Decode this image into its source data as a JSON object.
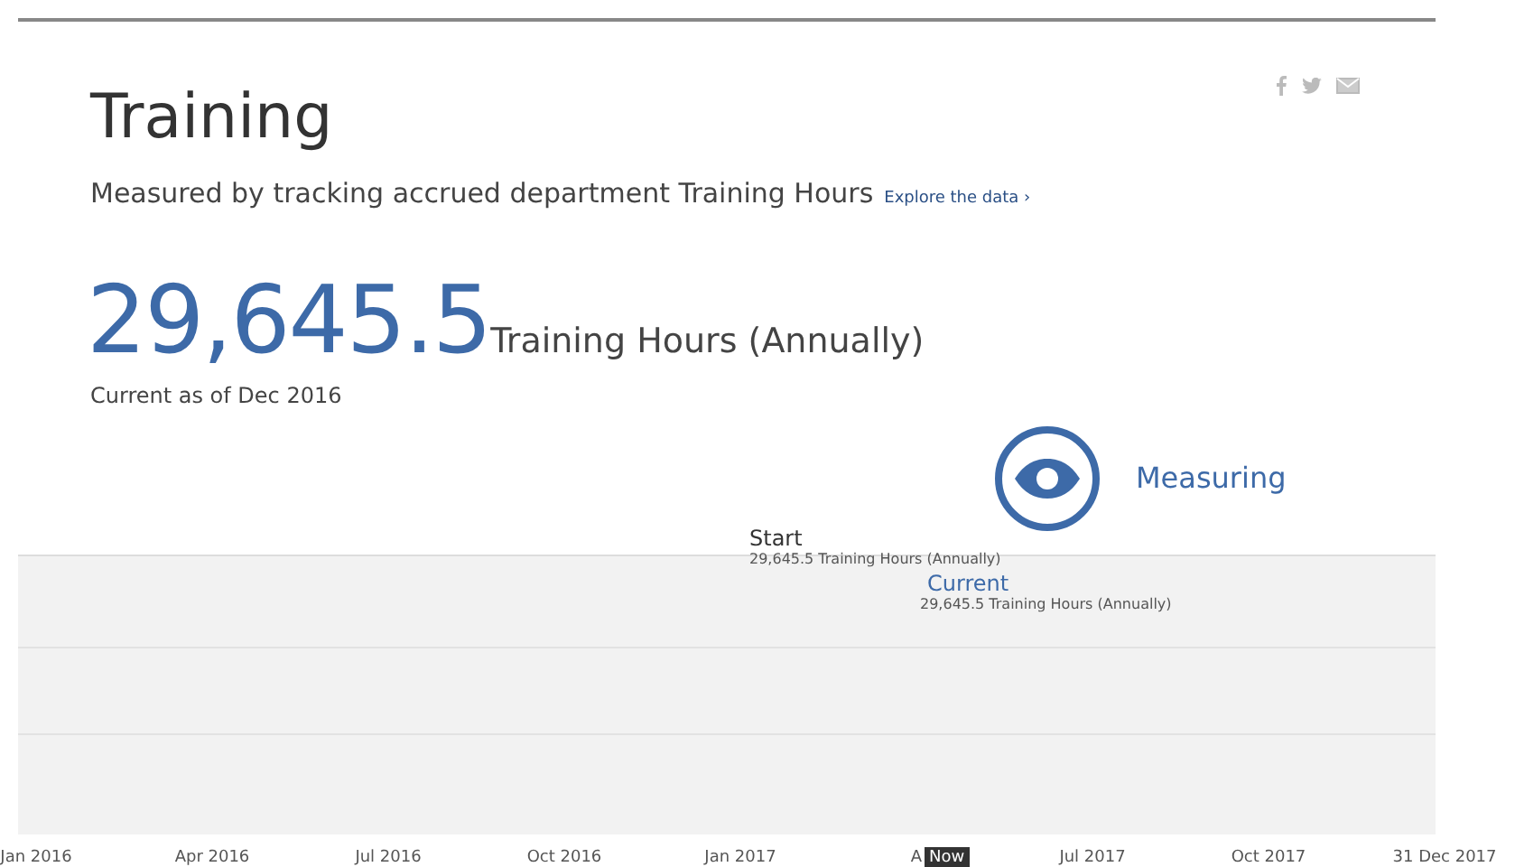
{
  "title": "Training",
  "subtitle": "Measured by tracking accrued department Training Hours",
  "explore_link": "Explore the data",
  "explore_chevron": "›",
  "value": "29,645.5",
  "unit": "Training Hours (Annually)",
  "as_of": "Current as of Dec 2016",
  "status": {
    "label": "Measuring"
  },
  "timeline": {
    "markers": [
      {
        "label": "Start",
        "value": "29,645.5 Training Hours (Annually)",
        "kind": "start"
      },
      {
        "label": "Current",
        "value": "29,645.5 Training Hours (Annually)",
        "kind": "current"
      }
    ],
    "ticks": [
      "Jan 2016",
      "Apr 2016",
      "Jul 2016",
      "Oct 2016",
      "Jan 2017",
      "A",
      "Jul 2017",
      "Oct 2017",
      "31 Dec 2017"
    ],
    "now_label": "Now"
  }
}
